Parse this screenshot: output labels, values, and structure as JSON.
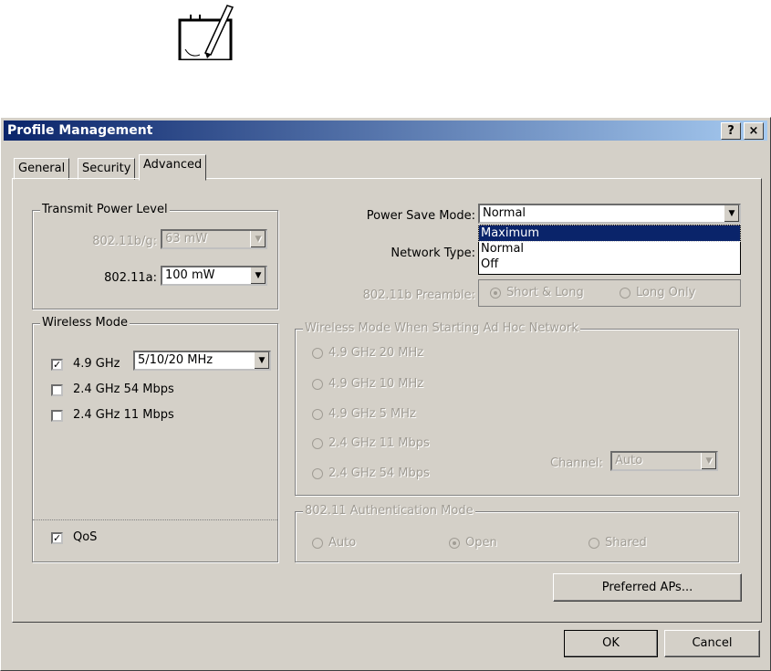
{
  "window": {
    "title": "Profile Management",
    "help": "?",
    "close": "×"
  },
  "tabs": [
    {
      "label": "General"
    },
    {
      "label": "Security"
    },
    {
      "label": "Advanced"
    }
  ],
  "transmit": {
    "legend": "Transmit Power Level",
    "bg_label": "802.11b/g:",
    "bg_value": "63 mW",
    "a_label": "802.11a:",
    "a_value": "100 mW"
  },
  "wireless_mode": {
    "legend": "Wireless Mode",
    "items": [
      {
        "label": "4.9 GHz",
        "checked": true,
        "combo": "5/10/20 MHz"
      },
      {
        "label": "2.4 GHz 54 Mbps",
        "checked": false
      },
      {
        "label": "2.4 GHz 11 Mbps",
        "checked": false
      }
    ],
    "qos": "QoS"
  },
  "power_save": {
    "label": "Power Save Mode:",
    "value": "Normal",
    "options": [
      "Maximum",
      "Normal",
      "Off"
    ],
    "highlighted": "Maximum"
  },
  "network_type": {
    "label": "Network Type:"
  },
  "preamble": {
    "label": "802.11b Preamble:",
    "options": [
      "Short & Long",
      "Long Only"
    ]
  },
  "adhoc": {
    "legend": "Wireless Mode When Starting Ad Hoc Network",
    "options": [
      "4.9 GHz 20 MHz",
      "4.9 GHz 10 MHz",
      "4.9 GHz 5 MHz",
      "2.4 GHz 11 Mbps",
      "2.4 GHz 54 Mbps"
    ],
    "channel_label": "Channel:",
    "channel_value": "Auto"
  },
  "auth": {
    "legend": "802.11 Authentication Mode",
    "options": [
      "Auto",
      "Open",
      "Shared"
    ]
  },
  "buttons": {
    "preferred": "Preferred APs...",
    "ok": "OK",
    "cancel": "Cancel"
  },
  "colors": {
    "titlebar": "#0a246a",
    "face": "#d4d0c8",
    "highlight": "#0a246a"
  }
}
